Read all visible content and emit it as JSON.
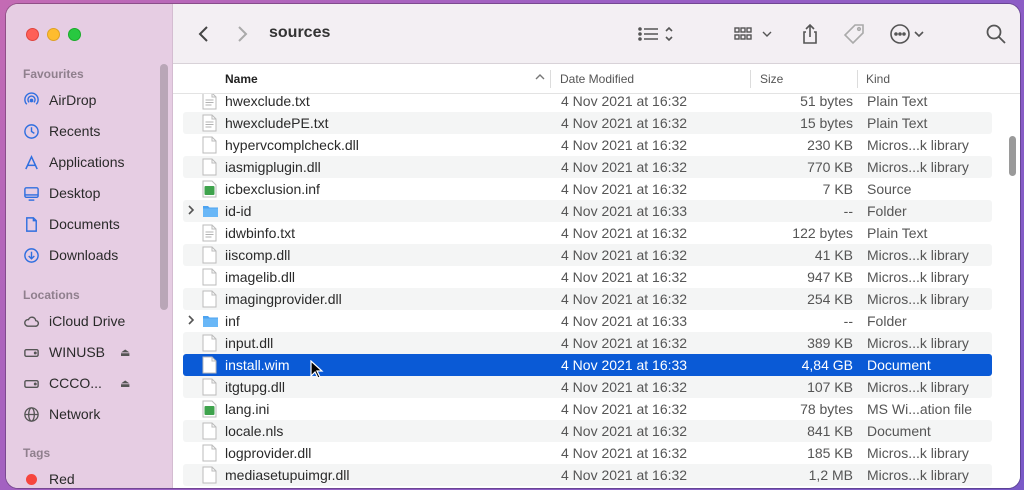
{
  "toolbar": {
    "back_icon": "chevron-left-icon",
    "forward_icon": "chevron-right-icon",
    "title": "sources"
  },
  "sidebar": {
    "favourites_label": "Favourites",
    "favourites": [
      {
        "label": "AirDrop",
        "icon": "airdrop-icon"
      },
      {
        "label": "Recents",
        "icon": "clock-icon"
      },
      {
        "label": "Applications",
        "icon": "applications-icon"
      },
      {
        "label": "Desktop",
        "icon": "desktop-icon"
      },
      {
        "label": "Documents",
        "icon": "document-icon"
      },
      {
        "label": "Downloads",
        "icon": "download-icon"
      }
    ],
    "locations_label": "Locations",
    "locations": [
      {
        "label": "iCloud Drive",
        "icon": "cloud-icon"
      },
      {
        "label": "WINUSB",
        "icon": "drive-icon"
      },
      {
        "label": "CCCO...",
        "icon": "drive-icon"
      },
      {
        "label": "Network",
        "icon": "network-icon"
      }
    ],
    "tags_label": "Tags",
    "tags": [
      {
        "label": "Red",
        "color": "#f6453e"
      }
    ]
  },
  "columns": {
    "name": "Name",
    "date": "Date Modified",
    "size": "Size",
    "kind": "Kind"
  },
  "files": [
    {
      "name": "hwexclude.txt",
      "date": "4 Nov 2021 at 16:32",
      "size": "51 bytes",
      "kind": "Plain Text",
      "type": "text"
    },
    {
      "name": "hwexcludePE.txt",
      "date": "4 Nov 2021 at 16:32",
      "size": "15 bytes",
      "kind": "Plain Text",
      "type": "text"
    },
    {
      "name": "hypervcomplcheck.dll",
      "date": "4 Nov 2021 at 16:32",
      "size": "230 KB",
      "kind": "Micros...k library",
      "type": "doc"
    },
    {
      "name": "iasmigplugin.dll",
      "date": "4 Nov 2021 at 16:32",
      "size": "770 KB",
      "kind": "Micros...k library",
      "type": "doc"
    },
    {
      "name": "icbexclusion.inf",
      "date": "4 Nov 2021 at 16:32",
      "size": "7 KB",
      "kind": "Source",
      "type": "source"
    },
    {
      "name": "id-id",
      "date": "4 Nov 2021 at 16:33",
      "size": "--",
      "kind": "Folder",
      "type": "folder"
    },
    {
      "name": "idwbinfo.txt",
      "date": "4 Nov 2021 at 16:32",
      "size": "122 bytes",
      "kind": "Plain Text",
      "type": "text"
    },
    {
      "name": "iiscomp.dll",
      "date": "4 Nov 2021 at 16:32",
      "size": "41 KB",
      "kind": "Micros...k library",
      "type": "doc"
    },
    {
      "name": "imagelib.dll",
      "date": "4 Nov 2021 at 16:32",
      "size": "947 KB",
      "kind": "Micros...k library",
      "type": "doc"
    },
    {
      "name": "imagingprovider.dll",
      "date": "4 Nov 2021 at 16:32",
      "size": "254 KB",
      "kind": "Micros...k library",
      "type": "doc"
    },
    {
      "name": "inf",
      "date": "4 Nov 2021 at 16:33",
      "size": "--",
      "kind": "Folder",
      "type": "folder"
    },
    {
      "name": "input.dll",
      "date": "4 Nov 2021 at 16:32",
      "size": "389 KB",
      "kind": "Micros...k library",
      "type": "doc"
    },
    {
      "name": "install.wim",
      "date": "4 Nov 2021 at 16:33",
      "size": "4,84 GB",
      "kind": "Document",
      "type": "doc",
      "selected": true
    },
    {
      "name": "itgtupg.dll",
      "date": "4 Nov 2021 at 16:32",
      "size": "107 KB",
      "kind": "Micros...k library",
      "type": "doc"
    },
    {
      "name": "lang.ini",
      "date": "4 Nov 2021 at 16:32",
      "size": "78 bytes",
      "kind": "MS Wi...ation file",
      "type": "source"
    },
    {
      "name": "locale.nls",
      "date": "4 Nov 2021 at 16:32",
      "size": "841 KB",
      "kind": "Document",
      "type": "doc"
    },
    {
      "name": "logprovider.dll",
      "date": "4 Nov 2021 at 16:32",
      "size": "185 KB",
      "kind": "Micros...k library",
      "type": "doc"
    },
    {
      "name": "mediasetupuimgr.dll",
      "date": "4 Nov 2021 at 16:32",
      "size": "1,2 MB",
      "kind": "Micros...k library",
      "type": "doc"
    }
  ]
}
